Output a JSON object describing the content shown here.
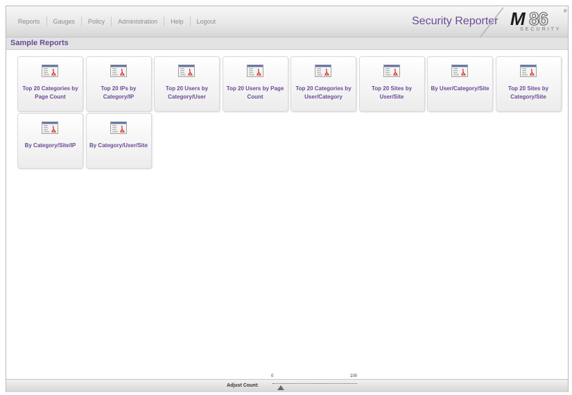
{
  "nav": {
    "items": [
      {
        "label": "Reports"
      },
      {
        "label": "Gauges"
      },
      {
        "label": "Policy"
      },
      {
        "label": "Administration"
      },
      {
        "label": "Help"
      },
      {
        "label": "Logout"
      }
    ]
  },
  "header": {
    "app_title": "Security Reporter",
    "logo": {
      "mark": "M86",
      "registered": "®",
      "tagline": "SECURITY"
    }
  },
  "section": {
    "title": "Sample Reports"
  },
  "reports": [
    {
      "label": "Top 20 Categories by Page Count",
      "icon": "report-pdf-icon"
    },
    {
      "label": "Top 20 IPs by Category/IP",
      "icon": "report-pdf-icon"
    },
    {
      "label": "Top 20 Users by Category/User",
      "icon": "report-pdf-icon"
    },
    {
      "label": "Top 20 Users by Page Count",
      "icon": "report-pdf-icon"
    },
    {
      "label": "Top 20 Categories by User/Category",
      "icon": "report-pdf-icon"
    },
    {
      "label": "Top 20 Sites by User/Site",
      "icon": "report-pdf-icon"
    },
    {
      "label": "By User/Category/Site",
      "icon": "report-pdf-icon"
    },
    {
      "label": "Top 20 Sites by Category/Site",
      "icon": "report-pdf-icon"
    },
    {
      "label": "By Category/Site/IP",
      "icon": "report-pdf-icon"
    },
    {
      "label": "By Category/User/Site",
      "icon": "report-pdf-icon"
    }
  ],
  "footer": {
    "adjust_label": "Adjust Count:",
    "slider": {
      "min": "0",
      "max": "100",
      "value": 10
    }
  },
  "colors": {
    "accent": "#6a4a96",
    "pdf_red": "#d6281e"
  }
}
